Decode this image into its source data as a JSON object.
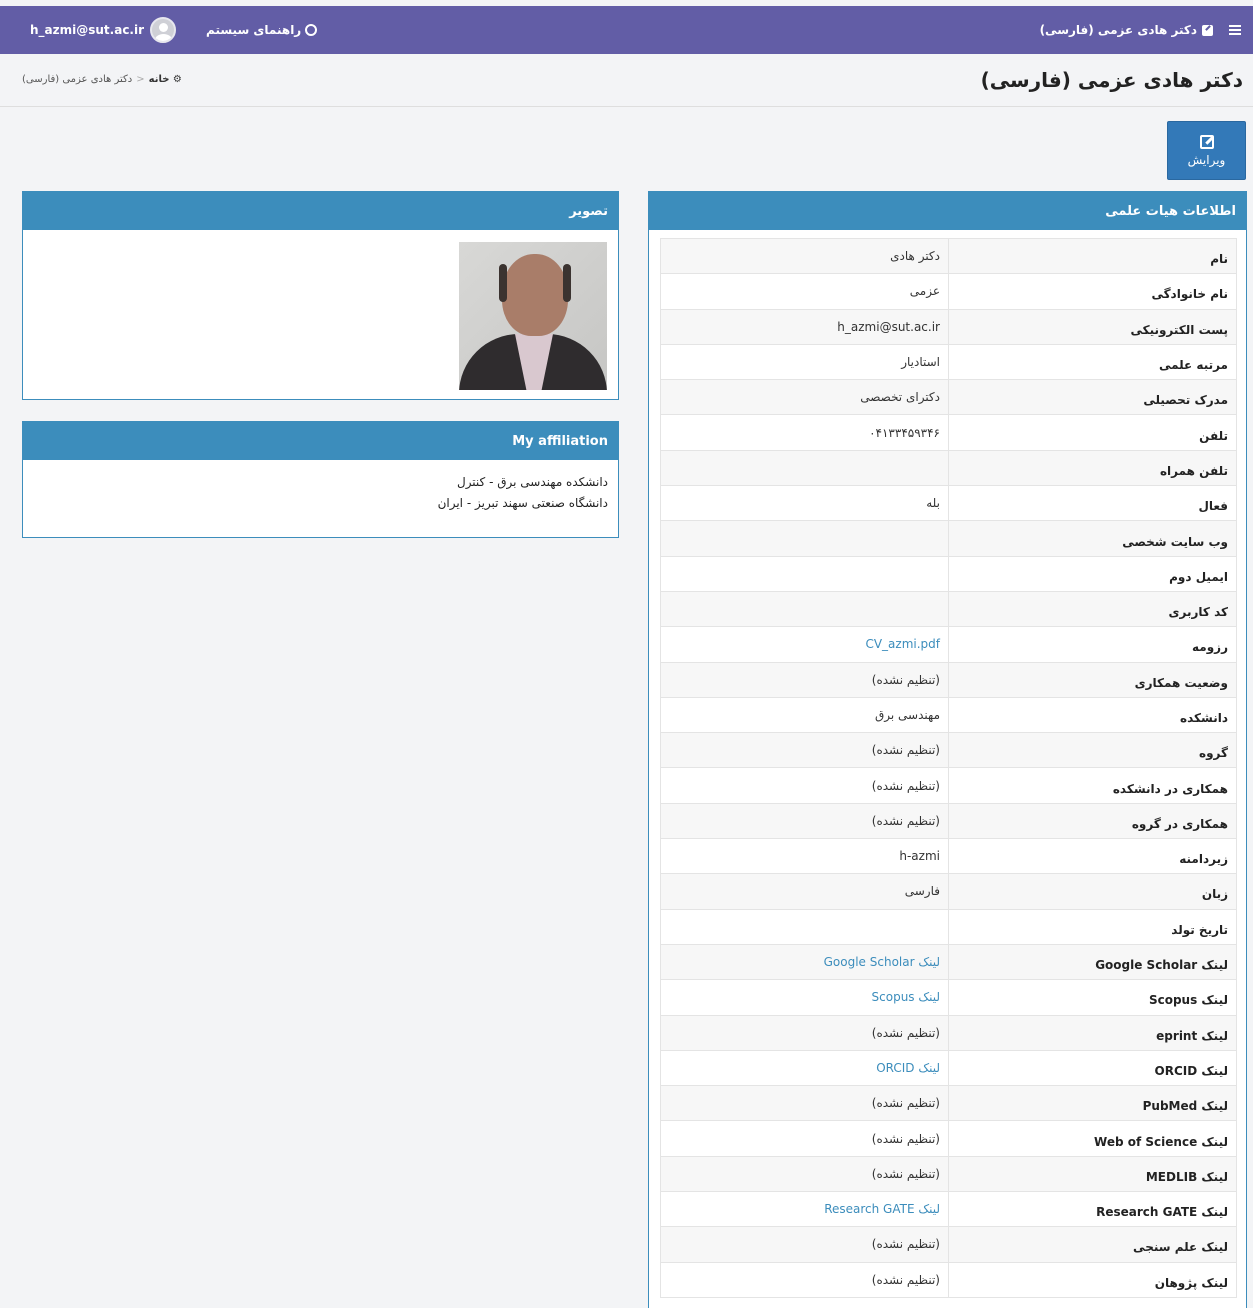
{
  "topbar": {
    "brand": "دکتر هادی عزمی (فارسی)",
    "help": "راهنمای سیستم",
    "user_email": "h_azmi@sut.ac.ir"
  },
  "breadcrumb": {
    "home": "خانه",
    "separator": "<",
    "current": "دکتر هادی عزمی (فارسی)"
  },
  "page_title": "دکتر هادی عزمی (فارسی)",
  "edit_button": "ویرایش",
  "info_panel": {
    "title": "اطلاعات هیات علمی",
    "rows": [
      {
        "label": "نام",
        "value": "دکتر هادی",
        "link": false
      },
      {
        "label": "نام خانوادگی",
        "value": "عزمی",
        "link": false
      },
      {
        "label": "پست الکترونیکی",
        "value": "h_azmi@sut.ac.ir",
        "link": false
      },
      {
        "label": "مرتبه علمی",
        "value": "استادیار",
        "link": false
      },
      {
        "label": "مدرک تحصیلی",
        "value": "دکترای تخصصی",
        "link": false
      },
      {
        "label": "تلفن",
        "value": "۰۴۱۳۳۴۵۹۳۴۶",
        "link": false
      },
      {
        "label": "تلفن همراه",
        "value": "",
        "link": false
      },
      {
        "label": "فعال",
        "value": "بله",
        "link": false
      },
      {
        "label": "وب سایت شخصی",
        "value": "",
        "link": false
      },
      {
        "label": "ایمیل دوم",
        "value": "",
        "link": false
      },
      {
        "label": "کد کاربری",
        "value": "",
        "link": false
      },
      {
        "label": "رزومه",
        "value": "CV_azmi.pdf",
        "link": true
      },
      {
        "label": "وضعیت همکاری",
        "value": "(تنظیم نشده)",
        "link": false
      },
      {
        "label": "دانشکده",
        "value": "مهندسی برق",
        "link": false
      },
      {
        "label": "گروه",
        "value": "(تنظیم نشده)",
        "link": false
      },
      {
        "label": "همکاری در دانشکده",
        "value": "(تنظیم نشده)",
        "link": false
      },
      {
        "label": "همکاری در گروه",
        "value": "(تنظیم نشده)",
        "link": false
      },
      {
        "label": "زیردامنه",
        "value": "h-azmi",
        "link": false
      },
      {
        "label": "زبان",
        "value": "فارسی",
        "link": false
      },
      {
        "label": "تاریخ تولد",
        "value": "",
        "link": false
      },
      {
        "label": "لینک Google Scholar",
        "value": "لینک Google Scholar",
        "link": true
      },
      {
        "label": "لینک Scopus",
        "value": "لینک Scopus",
        "link": true
      },
      {
        "label": "لینک eprint",
        "value": "(تنظیم نشده)",
        "link": false
      },
      {
        "label": "لینک ORCID",
        "value": "لینک ORCID",
        "link": true
      },
      {
        "label": "لینک PubMed",
        "value": "(تنظیم نشده)",
        "link": false
      },
      {
        "label": "لینک Web of Science",
        "value": "(تنظیم نشده)",
        "link": false
      },
      {
        "label": "لینک MEDLIB",
        "value": "(تنظیم نشده)",
        "link": false
      },
      {
        "label": "لینک Research GATE",
        "value": "لینک Research GATE",
        "link": true
      },
      {
        "label": "لینک علم سنجی",
        "value": "(تنظیم نشده)",
        "link": false
      },
      {
        "label": "لینک پژوهان",
        "value": "(تنظیم نشده)",
        "link": false
      }
    ]
  },
  "photo_panel": {
    "title": "تصویر"
  },
  "affiliation_panel": {
    "title": "My affiliation",
    "lines": [
      "دانشکده مهندسی برق - کنترل",
      "دانشگاه صنعتی سهند تبریز - ایران"
    ]
  },
  "colors": {
    "topbar": "#625da6",
    "panel_header": "#3c8dbc",
    "button": "#3379b8",
    "link": "#3c8dbc"
  }
}
